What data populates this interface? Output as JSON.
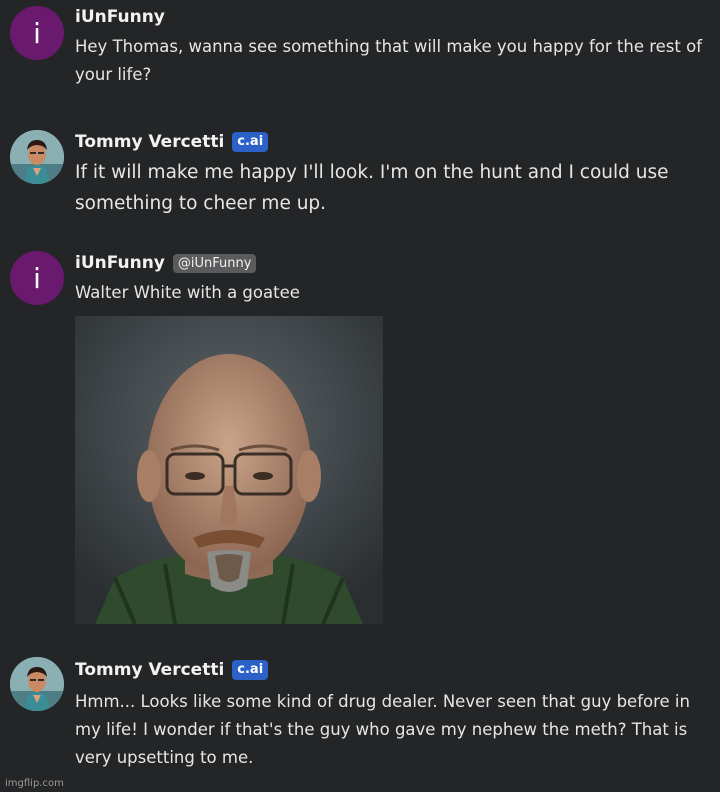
{
  "messages": [
    {
      "author": "iUnFunny",
      "avatar_letter": "i",
      "text": "Hey Thomas, wanna see something that will make you happy for the rest of your life?"
    },
    {
      "author": "Tommy Vercetti",
      "badge": "c.ai",
      "text": "If it will make me happy I'll look. I'm on the hunt and I could use something to cheer me up."
    },
    {
      "author": "iUnFunny",
      "avatar_letter": "i",
      "handle": "@iUnFunny",
      "text": "Walter White with a goatee"
    },
    {
      "author": "Tommy Vercetti",
      "badge": "c.ai",
      "text": "Hmm... Looks like some kind of drug dealer. Never seen that guy before in my life! I wonder if that's the guy who gave my nephew the meth? That is very upsetting to me."
    }
  ],
  "watermark": "imgflip.com",
  "colors": {
    "background": "#242526",
    "user_avatar": "#6a1a6e",
    "cai_badge": "#2c62c7",
    "handle_badge": "#5a5b5d"
  },
  "icons": {
    "user_avatar": "letter-i-avatar",
    "character_avatar": "tommy-vercetti-portrait"
  }
}
